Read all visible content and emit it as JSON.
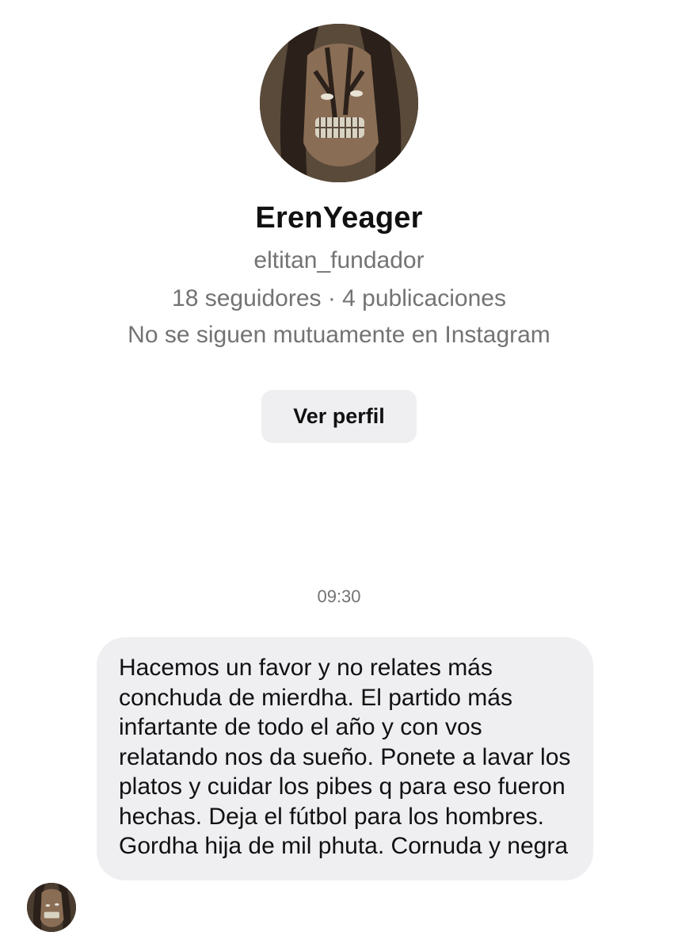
{
  "profile": {
    "display_name": "ErenYeager",
    "username": "eltitan_fundador",
    "stats": "18 seguidores · 4 publicaciones",
    "mutual_note": "No se siguen mutuamente en Instagram",
    "view_profile_label": "Ver perfil",
    "avatar_icon": "profile-photo"
  },
  "thread": {
    "timestamp": "09:30",
    "messages": [
      {
        "sender": "ErenYeager",
        "text": "Hacemos un favor y no relates más conchuda de mierdha. El partido más infartante de todo el año y con vos relatando nos da sueño. Ponete a lavar los platos y cuidar los pibes q para eso fueron hechas. Deja el fútbol para los hombres. Gordha hija de mil phuta. Cornuda y negra"
      }
    ]
  },
  "colors": {
    "background": "#ffffff",
    "primary_text": "#111111",
    "secondary_text": "#737373",
    "bubble": "#efeff2"
  }
}
